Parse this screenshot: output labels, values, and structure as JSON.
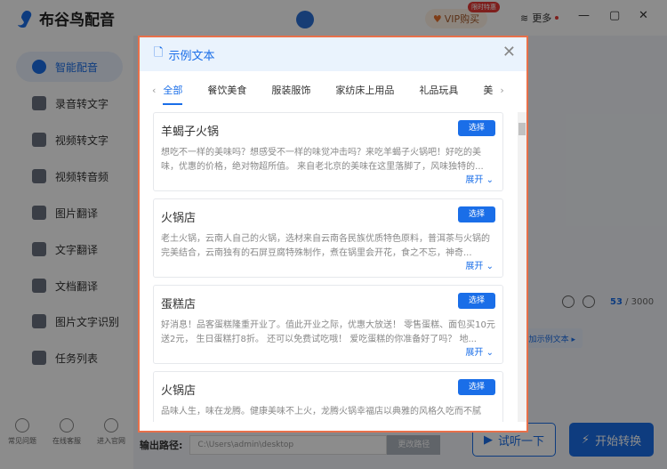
{
  "app": {
    "title": "布谷鸟配音",
    "vip_label": "VIP购买",
    "vip_badge": "限时特惠",
    "more_label": "更多"
  },
  "sidebar": {
    "items": [
      {
        "label": "智能配音"
      },
      {
        "label": "录音转文字"
      },
      {
        "label": "视频转文字"
      },
      {
        "label": "视频转音频"
      },
      {
        "label": "图片翻译"
      },
      {
        "label": "文字翻译"
      },
      {
        "label": "文档翻译"
      },
      {
        "label": "图片文字识别"
      },
      {
        "label": "任务列表"
      }
    ],
    "bottom": [
      {
        "label": "常见问题"
      },
      {
        "label": "在线客服"
      },
      {
        "label": "进入官网"
      }
    ]
  },
  "main": {
    "count": "53",
    "max": " / 3000",
    "add_sample": "添加示例文本 ▸",
    "output_label": "输出路径:",
    "output_path": "C:\\Users\\admin\\desktop",
    "change_path": "更改路径",
    "try_label": "试听一下",
    "start_label": "开始转换"
  },
  "dialog": {
    "title": "示例文本",
    "tabs": [
      "全部",
      "餐饮美食",
      "服装服饰",
      "家纺床上用品",
      "礼品玩具",
      "美"
    ],
    "select_label": "选择",
    "expand_label": "展开",
    "cards": [
      {
        "title": "羊蝎子火锅",
        "text": "想吃不一样的美味吗？想感受不一样的味觉冲击吗？来吃羊蝎子火锅吧！好吃的美味，优惠的价格，绝对物超所值。 来自老北京的美味在这里落脚了，风味独特的..."
      },
      {
        "title": "火锅店",
        "text": "老土火锅，云南人自己的火锅，选材来自云南各民族优质特色原料，普洱茶与火锅的完美结合，云南独有的石屏豆腐特殊制作，煮在锅里会开花，食之不忘，神奇..."
      },
      {
        "title": "蛋糕店",
        "text": "好消息！品客蛋糕隆重开业了。值此开业之际，优惠大放送！ 零售蛋糕、面包买10元送2元， 生日蛋糕打8折。 还可以免费试吃哦！ 爱吃蛋糕的你准备好了吗？ 地..."
      },
      {
        "title": "火锅店",
        "text": "品味人生，味在龙腾。健康美味不上火，龙腾火锅幸福店以典雅的风格久吃而不腻"
      }
    ]
  }
}
